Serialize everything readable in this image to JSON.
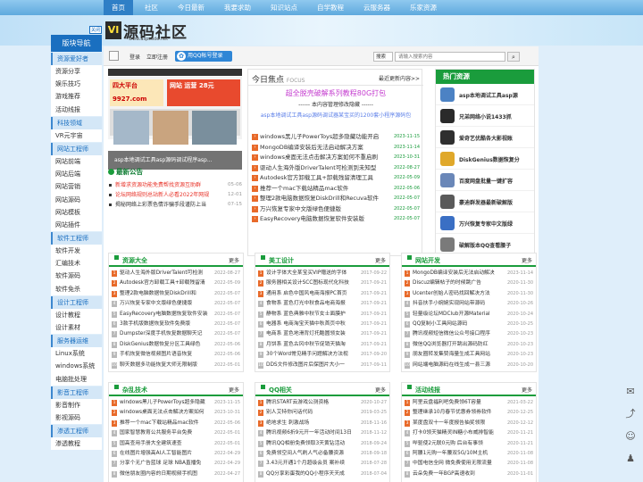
{
  "topnav": [
    "首页",
    "社区",
    "今日最新",
    "我要求助",
    "知识站点",
    "自学教程",
    "云服务器",
    "乐家资源"
  ],
  "logo": {
    "mark": "VI",
    "name": "源码社区",
    "sub": "www.aspcode.net"
  },
  "sidebar": {
    "title": "版块导航",
    "close": "关闭",
    "groups": [
      {
        "cat": "资源爱好者",
        "items": [
          "资源分享",
          "娱乐技巧",
          "游戏推荐",
          "活动线报"
        ]
      },
      {
        "cat": "科技领域",
        "items": [
          "VR元宇宙"
        ]
      },
      {
        "cat": "网站工程师",
        "items": [
          "网站前端",
          "网站后端",
          "网站营销",
          "网站源码",
          "网站模板",
          "网站插件"
        ]
      },
      {
        "cat": "软件工程师",
        "items": [
          "软件开发",
          "汇编技术",
          "软件源码",
          "软件免杀"
        ]
      },
      {
        "cat": "设计工程师",
        "items": [
          "设计教程",
          "设计素材"
        ]
      },
      {
        "cat": "服务器运维",
        "items": [
          "Linux系统",
          "windows系统",
          "电脑批处理"
        ]
      },
      {
        "cat": "影音工程师",
        "items": [
          "影音制作",
          "影视源码"
        ]
      },
      {
        "cat": "渗透工程师",
        "items": [
          "渗透教程"
        ]
      }
    ]
  },
  "userbar": {
    "login": "登录",
    "register": "立即注册",
    "qq_login": "用QQ帐号登录",
    "search_select": "搜索",
    "search_placeholder": "请输入搜索内容",
    "search_icon": "magnifier-icon"
  },
  "slide": {
    "promo_a": "四大平台 9927.com",
    "promo_b": "网站 运营 28元",
    "caption": "asp本地调试工具asp源码调试程序asp...",
    "latest_title": "最新公告",
    "latest": [
      {
        "t": "新增求资源功能免费帮找资源互助群",
        "d": "05-06",
        "c": "#e8342a"
      },
      {
        "t": "论坛网络规则总站新人必看2022年网规",
        "d": "12-01",
        "c": "#e8342a"
      },
      {
        "t": "揭秘网络上彩票色情诈骗手段谨防上当",
        "d": "07-15",
        "c": "#333"
      }
    ]
  },
  "focus": {
    "title": "今日焦点",
    "title_en": "FOCUS",
    "more": "最近更新内容>>",
    "big": "超全脱壳破解系列教程80G打包",
    "notice": "------ 本内容管理修改隐藏 ------",
    "promo": "asp本地调试工具asp源码调试器某宝买的1200套小程序源码包",
    "list": [
      {
        "t": "windows黑儿子PowerToys超多隐藏功能开启",
        "d": "2023-11-15"
      },
      {
        "t": "MongoDB编译安装后无法启动解决方案",
        "d": "2023-11-14"
      },
      {
        "t": "windows桌面无法点击解决方案如何不重启刷",
        "d": "2023-10-31"
      },
      {
        "t": "驱动人生海外版DriverTalent可检测到未知型",
        "d": "2022-08-27"
      },
      {
        "t": "Autodesk官方卸载工具+卸载残留清理工具",
        "d": "2022-05-09"
      },
      {
        "t": "推荐一个mac下载站精品mac软件",
        "d": "2022-05-06"
      },
      {
        "t": "整理2款电脑数据恢复DiskDrill和Recuva软件",
        "d": "2022-05-07"
      },
      {
        "t": "万兴恢复专家中文版绿色便捷版",
        "d": "2022-05-07"
      },
      {
        "t": "EasyRecovery电脑数据恢复软件安装版",
        "d": "2022-05-07"
      }
    ]
  },
  "hot": {
    "title": "热门资源",
    "items": [
      {
        "t": "asp本地调试工具asp源",
        "c": "#4c82c4"
      },
      {
        "t": "兄弟网络小说1433抓",
        "c": "#2a2a2a"
      },
      {
        "t": "爱奇艺优酷各大影视账",
        "c": "#2f2f2f"
      },
      {
        "t": "DiskGenius数据恢复分",
        "c": "#e0a82a"
      },
      {
        "t": "百度网盘批量一键扩容",
        "c": "#6a87b8"
      },
      {
        "t": "豪迪群发器最新破解版",
        "c": "#5a5a5a"
      },
      {
        "t": "万兴恢复专家中文版绿",
        "c": "#3a6fc4"
      },
      {
        "t": "破解版本QQ查看腰子",
        "c": "#7a7a7a"
      }
    ]
  },
  "panels": [
    {
      "title": "资源大全",
      "more": "更多",
      "rows": [
        {
          "t": "驱动人生海外版DriverTalent可检测",
          "d": "2022-08-27"
        },
        {
          "t": "Autodesk官方卸载工具+卸载残留清",
          "d": "2022-05-09"
        },
        {
          "t": "整理2款电脑数据恢复DiskDrill和",
          "d": "2022-05-07"
        },
        {
          "t": "万兴恢复专家中文版绿色便捷版",
          "d": "2022-05-07"
        },
        {
          "t": "EasyRecovery电脑数据恢复软件安装",
          "d": "2022-05-07"
        },
        {
          "t": "3款手机版数据恢复软件免费版",
          "d": "2022-05-07"
        },
        {
          "t": "Dumpster深度手机恢复数据聊天记",
          "d": "2022-05-07"
        },
        {
          "t": "DiskGenius数据恢复分区工具绿色",
          "d": "2022-05-06"
        },
        {
          "t": "手机恢复微信视频图片语音恢复",
          "d": "2022-05-06"
        },
        {
          "t": "聊天数据多功能恢复大师无限制版",
          "d": "2022-05-01"
        }
      ]
    },
    {
      "title": "美工设计",
      "more": "更多",
      "rows": [
        {
          "t": "设计字体大全某宝买VIP赠送的字体",
          "d": "2017-09-22"
        },
        {
          "t": "服务器相关设计SCC图标现代化科技",
          "d": "2017-09-21"
        },
        {
          "t": "通用系 启色中国风电商海报PC首页",
          "d": "2017-09-21"
        },
        {
          "t": "食物系 蓝色打光中秋食品电商海报",
          "d": "2017-09-21"
        },
        {
          "t": "静物系 蓝色典雅中秋节女士面膜护",
          "d": "2017-09-21"
        },
        {
          "t": "电器系 电商淘宝天猫中秋首页中秋",
          "d": "2017-09-21"
        },
        {
          "t": "电商系 蓝色地滑背灯托酷圆领女装",
          "d": "2017-09-21"
        },
        {
          "t": "月饼系 蓝色古风中秋节促销天猫淘",
          "d": "2017-09-21"
        },
        {
          "t": "30个Word常见精手问题解决方法视",
          "d": "2017-09-20"
        },
        {
          "t": "DDS文件修改图片后保图片大小一",
          "d": "2017-09-11"
        }
      ]
    },
    {
      "title": "网站开发",
      "more": "更多",
      "rows": [
        {
          "t": "MongoDB编译安装后无法启动解决",
          "d": "2023-11-14"
        },
        {
          "t": "Discuz编辑帖子的时候跳广告",
          "d": "2020-11-30"
        },
        {
          "t": "Ucenter创始人密码找回解决方法",
          "d": "2020-11-30"
        },
        {
          "t": "抖音扶手小婉婉实现网站带源码",
          "d": "2020-10-26"
        },
        {
          "t": "轻量级论坛MDClub开源Material",
          "d": "2020-10-24"
        },
        {
          "t": "QQ复制小工具网站源码",
          "d": "2020-10-25"
        },
        {
          "t": "腾讯视频短信微信公众号接口程序",
          "d": "2020-10-23"
        },
        {
          "t": "微信QQ浏览器打开跳出源码防红",
          "d": "2020-10-23"
        },
        {
          "t": "朋友圈转发集赞海量生成工具网站",
          "d": "2020-10-23"
        },
        {
          "t": "网站端电脑源码在线生成一县三源",
          "d": "2020-10-20"
        }
      ]
    },
    {
      "title": "杂乱技术",
      "more": "更多",
      "rows": [
        {
          "t": "windows黑儿子PowerToys超多隐藏",
          "d": "2023-11-15"
        },
        {
          "t": "windows桌面无法点击解决方案如何",
          "d": "2023-10-31"
        },
        {
          "t": "推荐一个mac下载站精品mac软件",
          "d": "2022-05-06"
        },
        {
          "t": "国家智慧教育公共服务平台免费",
          "d": "2022-05-01"
        },
        {
          "t": "国高查用手册大全建筑速查",
          "d": "2022-05-01"
        },
        {
          "t": "在线图片增强高AI人工智能图片",
          "d": "2022-04-29"
        },
        {
          "t": "分享个无广告蓝球 足球 NBA直播免",
          "d": "2022-04-29"
        },
        {
          "t": "微信朋友圈内容的日期视频手机图",
          "d": "2022-04-27"
        }
      ]
    },
    {
      "title": "QQ相关",
      "more": "更多",
      "rows": [
        {
          "t": "腾讯START云游戏公测资格",
          "d": "2020-10-27"
        },
        {
          "t": "别人艾特你问话代码",
          "d": "2019-03-25"
        },
        {
          "t": "绝地求生 刺激战场",
          "d": "2018-11-16"
        },
        {
          "t": "腾讯视频6折9元开一年活动时间13日",
          "d": "2018-11-12"
        },
        {
          "t": "腾讯QQ相册免费领取3天黄钻活动",
          "d": "2018-09-24"
        },
        {
          "t": "免费领空间人气刷人气必备腰资源",
          "d": "2018-09-18"
        },
        {
          "t": "3.43元开通1个月超级会员 案补续",
          "d": "2018-07-28"
        },
        {
          "t": "QQ分享彩蛋我的QQ小程序天天成",
          "d": "2018-07-04"
        }
      ]
    },
    {
      "title": "活动线报",
      "more": "更多",
      "rows": [
        {
          "t": "阿里云盘福利吧免费领6T容量",
          "d": "2021-03-22"
        },
        {
          "t": "整理继承10月春节优惠券领券软件",
          "d": "2020-12-25"
        },
        {
          "t": "某度盘双十一年度报告抽奖领限",
          "d": "2020-12-12"
        },
        {
          "t": "打卡0领天猫精灵IN糖小布威排智能",
          "d": "2020-11-21"
        },
        {
          "t": "哔驱使2元联0元购 后台有事领",
          "d": "2020-11-21"
        },
        {
          "t": "阿腰1元购一年腰双5G/10M主机",
          "d": "2020-11-08"
        },
        {
          "t": "中国电信全网 微免费使用无限流量",
          "d": "2020-11-08"
        },
        {
          "t": "云朵免费一年BGP高速收到",
          "d": "2020-11-01"
        }
      ]
    }
  ],
  "right_tools": [
    "message-icon",
    "share-icon",
    "wechat-icon",
    "user-icon"
  ]
}
